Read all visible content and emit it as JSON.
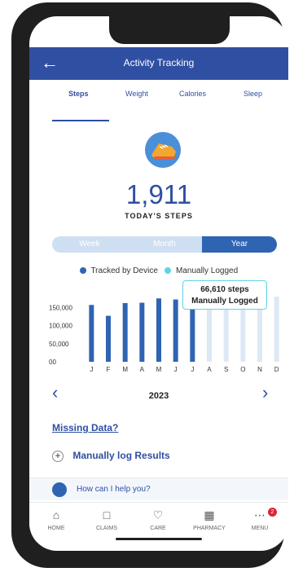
{
  "header": {
    "title": "Activity Tracking",
    "back_icon": "arrow-left-icon"
  },
  "tabs": [
    {
      "label": "Steps",
      "active": true
    },
    {
      "label": "Weight",
      "active": false
    },
    {
      "label": "Calories",
      "active": false
    },
    {
      "label": "Sleep",
      "active": false
    }
  ],
  "summary": {
    "value": "1,911",
    "label": "TODAY'S STEPS",
    "icon": "running-shoe-icon"
  },
  "range_selector": [
    {
      "label": "Week",
      "active": false
    },
    {
      "label": "Month",
      "active": false
    },
    {
      "label": "Year",
      "active": true
    }
  ],
  "legend": {
    "tracked": "Tracked by Device",
    "manual": "Manually Logged"
  },
  "tooltip": {
    "value": "66,610 steps",
    "label": "Manually Logged"
  },
  "chart_data": {
    "type": "bar",
    "categories": [
      "J",
      "F",
      "M",
      "A",
      "M",
      "J",
      "J",
      "A",
      "S",
      "O",
      "N",
      "D"
    ],
    "ytick_labels": [
      "150,000",
      "100,000",
      "50,000",
      "00"
    ],
    "ylim": [
      0,
      180000
    ],
    "series": [
      {
        "name": "Tracked by Device",
        "values": [
          157000,
          127000,
          162000,
          163000,
          175000,
          172000,
          170000,
          0,
          0,
          0,
          0,
          0
        ]
      },
      {
        "name": "Manually Logged",
        "values": [
          0,
          0,
          0,
          0,
          0,
          0,
          66610,
          0,
          0,
          0,
          0,
          0
        ]
      }
    ],
    "colors": {
      "tracked": "#2f64b2",
      "manual": "#5fd3e6",
      "empty": "#dde8f5"
    }
  },
  "year_nav": {
    "year": "2023",
    "prev_icon": "chevron-left-icon",
    "next_icon": "chevron-right-icon"
  },
  "links": {
    "missing_data": "Missing Data?",
    "manual_log": "Manually log Results"
  },
  "help": {
    "text": "How can I help you?"
  },
  "bottom_nav": [
    {
      "label": "HOME",
      "icon": "home-icon"
    },
    {
      "label": "CLAIMS",
      "icon": "clipboard-icon"
    },
    {
      "label": "CARE",
      "icon": "heart-pulse-icon"
    },
    {
      "label": "PHARMACY",
      "icon": "pharmacy-icon"
    },
    {
      "label": "MENU",
      "icon": "menu-icon",
      "badge": "2"
    }
  ]
}
